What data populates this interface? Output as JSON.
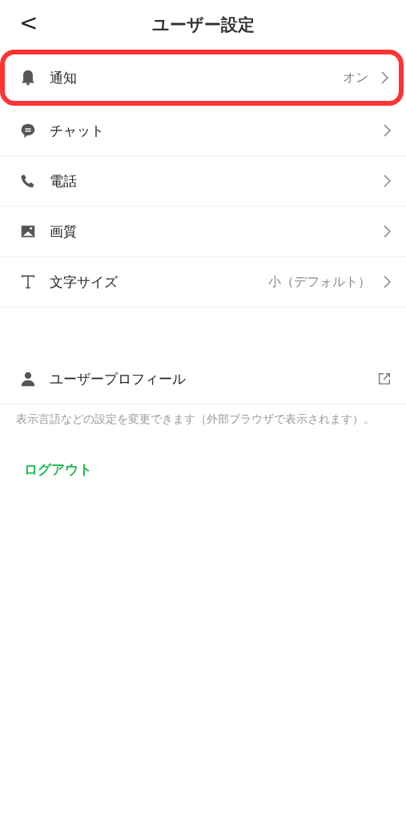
{
  "header": {
    "back": "<",
    "title": "ユーザー設定"
  },
  "settings": [
    {
      "label": "通知",
      "value": "オン",
      "highlighted": true
    },
    {
      "label": "チャット",
      "highlighted": false
    },
    {
      "label": "電話",
      "highlighted": false
    },
    {
      "label": "画質",
      "highlighted": false
    },
    {
      "label": "文字サイズ",
      "value": "小（デフォルト）",
      "highlighted": false
    }
  ],
  "profile": {
    "label": "ユーザープロフィール",
    "note": "表示言語などの設定を変更できます（外部ブラウザで表示されます）。"
  },
  "logout": "ログアウト"
}
